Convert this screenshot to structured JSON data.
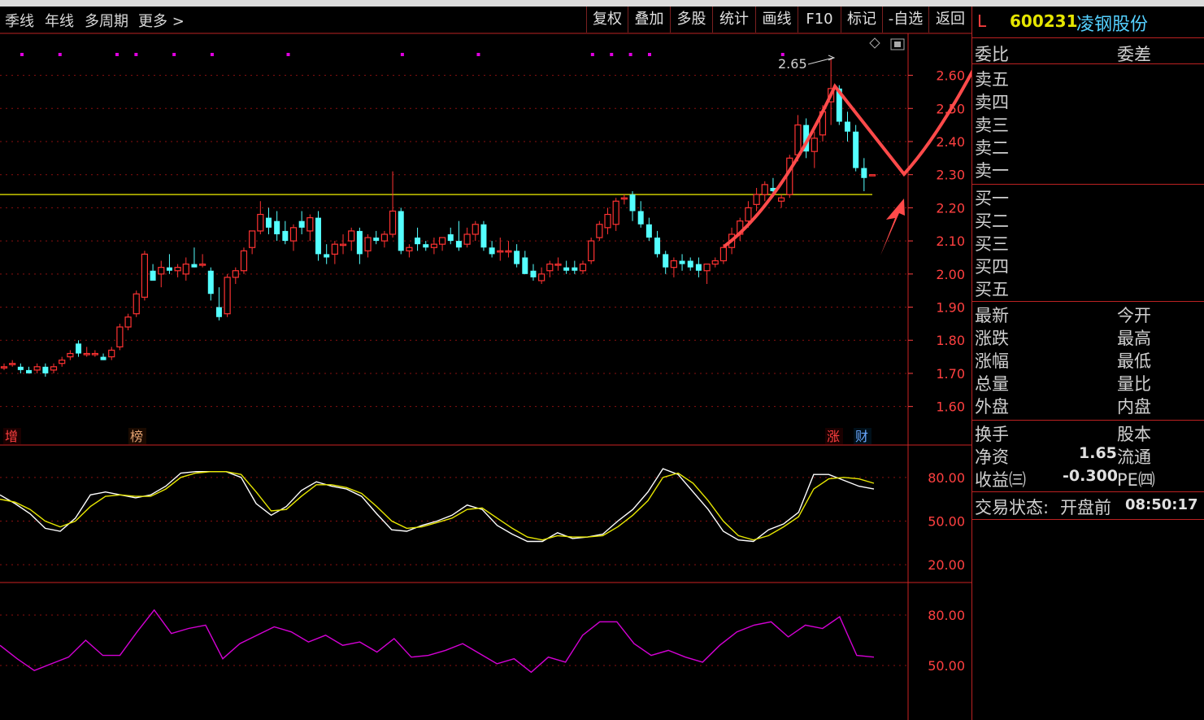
{
  "toolbar": {
    "left": [
      "季线",
      "年线",
      "多周期",
      "更多 >"
    ],
    "buttons": [
      "复权",
      "叠加",
      "多股",
      "统计",
      "画线",
      "F10",
      "标记",
      "-自选",
      "返回"
    ]
  },
  "stock": {
    "prefix": "L",
    "code": "600231",
    "name": "凌钢股份"
  },
  "order_book": {
    "header_left": "委比",
    "header_right": "委差",
    "asks": [
      "卖五",
      "卖四",
      "卖三",
      "卖二",
      "卖一"
    ],
    "bids": [
      "买一",
      "买二",
      "买三",
      "买四",
      "买五"
    ]
  },
  "quote_labels": {
    "left": [
      "最新",
      "涨跌",
      "涨幅",
      "总量",
      "外盘"
    ],
    "right": [
      "今开",
      "最高",
      "最低",
      "量比",
      "内盘"
    ]
  },
  "fundamentals": {
    "turnover_label": "换手",
    "share_cap_label": "股本",
    "net_asset_label": "净资",
    "net_asset_value": "1.65",
    "float_label": "流通",
    "eps_label": "收益㈢",
    "eps_value": "-0.300",
    "pe_label": "PE㈣"
  },
  "status": {
    "label": "交易状态:",
    "state": "开盘前",
    "time": "08:50:17"
  },
  "chart_markers": {
    "zeng": "增",
    "bang": "榜",
    "zhang": "涨",
    "cai": "财"
  },
  "colors": {
    "up": "#ff3232",
    "down": "#54ffff",
    "grid": "#8a1010",
    "axis": "#ff4040",
    "kd_k": "#ffffff",
    "kd_d": "#e6e600",
    "rsi": "#d400d4",
    "resistance": "#c8c800",
    "annotation": "#ff4a4a"
  },
  "chart_data": [
    {
      "type": "candlestick",
      "y_ticks": [
        "2.60",
        "2.50",
        "2.40",
        "2.30",
        "2.20",
        "2.10",
        "2.00",
        "1.90",
        "1.80",
        "1.70",
        "1.60"
      ],
      "ylim": [
        1.55,
        2.68
      ],
      "max_annotation": "2.65",
      "resistance_level": 2.24,
      "candles": [
        [
          1.72,
          1.73,
          1.71,
          1.72
        ],
        [
          1.73,
          1.74,
          1.72,
          1.73
        ],
        [
          1.72,
          1.73,
          1.7,
          1.71
        ],
        [
          1.71,
          1.72,
          1.7,
          1.7
        ],
        [
          1.71,
          1.73,
          1.7,
          1.72
        ],
        [
          1.72,
          1.73,
          1.69,
          1.7
        ],
        [
          1.71,
          1.73,
          1.7,
          1.72
        ],
        [
          1.73,
          1.75,
          1.72,
          1.74
        ],
        [
          1.75,
          1.77,
          1.74,
          1.76
        ],
        [
          1.79,
          1.8,
          1.75,
          1.76
        ],
        [
          1.76,
          1.78,
          1.75,
          1.76
        ],
        [
          1.76,
          1.77,
          1.75,
          1.76
        ],
        [
          1.75,
          1.76,
          1.74,
          1.74
        ],
        [
          1.75,
          1.78,
          1.74,
          1.77
        ],
        [
          1.78,
          1.85,
          1.77,
          1.84
        ],
        [
          1.84,
          1.88,
          1.83,
          1.87
        ],
        [
          1.88,
          1.95,
          1.87,
          1.94
        ],
        [
          1.93,
          2.07,
          1.92,
          2.06
        ],
        [
          2.01,
          2.03,
          1.98,
          1.98
        ],
        [
          2.0,
          2.04,
          1.96,
          2.02
        ],
        [
          2.02,
          2.06,
          2.0,
          2.01
        ],
        [
          2.01,
          2.03,
          1.99,
          2.02
        ],
        [
          2.0,
          2.05,
          1.98,
          2.03
        ],
        [
          2.03,
          2.08,
          2.02,
          2.02
        ],
        [
          2.03,
          2.06,
          2.02,
          2.03
        ],
        [
          2.01,
          2.02,
          1.92,
          1.94
        ],
        [
          1.9,
          1.96,
          1.86,
          1.87
        ],
        [
          1.88,
          2.0,
          1.87,
          1.99
        ],
        [
          1.99,
          2.02,
          1.97,
          2.01
        ],
        [
          2.01,
          2.08,
          2.0,
          2.07
        ],
        [
          2.08,
          2.13,
          2.06,
          2.13
        ],
        [
          2.13,
          2.22,
          2.12,
          2.18
        ],
        [
          2.17,
          2.2,
          2.12,
          2.14
        ],
        [
          2.16,
          2.19,
          2.1,
          2.12
        ],
        [
          2.13,
          2.16,
          2.09,
          2.1
        ],
        [
          2.1,
          2.15,
          2.07,
          2.14
        ],
        [
          2.16,
          2.19,
          2.12,
          2.14
        ],
        [
          2.13,
          2.18,
          2.1,
          2.17
        ],
        [
          2.17,
          2.19,
          2.04,
          2.06
        ],
        [
          2.06,
          2.09,
          2.03,
          2.05
        ],
        [
          2.06,
          2.1,
          2.03,
          2.09
        ],
        [
          2.09,
          2.12,
          2.06,
          2.09
        ],
        [
          2.1,
          2.14,
          2.07,
          2.13
        ],
        [
          2.13,
          2.14,
          2.03,
          2.06
        ],
        [
          2.07,
          2.12,
          2.05,
          2.11
        ],
        [
          2.11,
          2.13,
          2.09,
          2.1
        ],
        [
          2.1,
          2.13,
          2.08,
          2.12
        ],
        [
          2.12,
          2.31,
          2.11,
          2.19
        ],
        [
          2.19,
          2.2,
          2.06,
          2.07
        ],
        [
          2.07,
          2.09,
          2.05,
          2.08
        ],
        [
          2.11,
          2.14,
          2.07,
          2.09
        ],
        [
          2.09,
          2.1,
          2.07,
          2.08
        ],
        [
          2.08,
          2.11,
          2.06,
          2.09
        ],
        [
          2.09,
          2.11,
          2.07,
          2.11
        ],
        [
          2.12,
          2.14,
          2.09,
          2.1
        ],
        [
          2.1,
          2.16,
          2.07,
          2.08
        ],
        [
          2.09,
          2.14,
          2.08,
          2.12
        ],
        [
          2.12,
          2.16,
          2.1,
          2.15
        ],
        [
          2.15,
          2.16,
          2.07,
          2.08
        ],
        [
          2.08,
          2.1,
          2.05,
          2.06
        ],
        [
          2.07,
          2.11,
          2.04,
          2.07
        ],
        [
          2.07,
          2.1,
          2.05,
          2.07
        ],
        [
          2.07,
          2.09,
          2.02,
          2.03
        ],
        [
          2.05,
          2.07,
          2.0,
          2.0
        ],
        [
          2.01,
          2.03,
          1.98,
          1.99
        ],
        [
          1.98,
          2.02,
          1.97,
          2.0
        ],
        [
          2.01,
          2.04,
          1.99,
          2.03
        ],
        [
          2.03,
          2.05,
          2.01,
          2.03
        ],
        [
          2.02,
          2.04,
          2.0,
          2.01
        ],
        [
          2.02,
          2.04,
          2.0,
          2.01
        ],
        [
          2.01,
          2.04,
          2.0,
          2.03
        ],
        [
          2.04,
          2.11,
          2.03,
          2.1
        ],
        [
          2.11,
          2.16,
          2.1,
          2.15
        ],
        [
          2.14,
          2.2,
          2.12,
          2.18
        ],
        [
          2.15,
          2.23,
          2.13,
          2.22
        ],
        [
          2.23,
          2.24,
          2.21,
          2.23
        ],
        [
          2.24,
          2.25,
          2.16,
          2.19
        ],
        [
          2.19,
          2.22,
          2.14,
          2.15
        ],
        [
          2.15,
          2.17,
          2.1,
          2.11
        ],
        [
          2.11,
          2.13,
          2.05,
          2.06
        ],
        [
          2.06,
          2.07,
          2.0,
          2.02
        ],
        [
          2.02,
          2.05,
          1.99,
          2.04
        ],
        [
          2.04,
          2.06,
          2.01,
          2.03
        ],
        [
          2.04,
          2.05,
          2.01,
          2.02
        ],
        [
          2.03,
          2.05,
          1.99,
          2.01
        ],
        [
          2.01,
          2.03,
          1.97,
          2.03
        ],
        [
          2.03,
          2.05,
          2.02,
          2.04
        ],
        [
          2.04,
          2.09,
          2.03,
          2.08
        ],
        [
          2.08,
          2.14,
          2.06,
          2.12
        ],
        [
          2.12,
          2.17,
          2.1,
          2.16
        ],
        [
          2.16,
          2.22,
          2.14,
          2.2
        ],
        [
          2.21,
          2.26,
          2.19,
          2.24
        ],
        [
          2.24,
          2.28,
          2.22,
          2.27
        ],
        [
          2.26,
          2.29,
          2.24,
          2.25
        ],
        [
          2.22,
          2.24,
          2.2,
          2.23
        ],
        [
          2.24,
          2.36,
          2.23,
          2.35
        ],
        [
          2.36,
          2.48,
          2.34,
          2.45
        ],
        [
          2.45,
          2.47,
          2.35,
          2.37
        ],
        [
          2.37,
          2.43,
          2.32,
          2.41
        ],
        [
          2.42,
          2.51,
          2.4,
          2.49
        ],
        [
          2.52,
          2.65,
          2.45,
          2.56
        ],
        [
          2.56,
          2.57,
          2.45,
          2.46
        ],
        [
          2.46,
          2.49,
          2.4,
          2.43
        ],
        [
          2.43,
          2.45,
          2.31,
          2.32
        ],
        [
          2.32,
          2.35,
          2.25,
          2.29
        ],
        [
          2.3,
          2.3,
          2.3,
          2.3
        ]
      ],
      "signal_dot_columns": [
        0,
        2,
        5,
        6,
        8,
        10,
        14,
        20,
        24,
        30,
        31,
        32,
        33,
        40,
        48,
        49,
        50,
        55,
        59,
        62,
        64,
        66
      ]
    },
    {
      "type": "line",
      "y_ticks": [
        "80.00",
        "50.00",
        "20.00"
      ],
      "ylim": [
        10,
        95
      ],
      "series": [
        {
          "values": [
            68,
            62,
            55,
            45,
            43,
            52,
            68,
            70,
            68,
            66,
            68,
            74,
            83,
            84,
            84,
            84,
            80,
            62,
            54,
            60,
            71,
            77,
            74,
            72,
            67,
            55,
            44,
            43,
            47,
            50,
            54,
            61,
            58,
            47,
            41,
            36,
            36,
            42,
            38,
            39,
            41,
            50,
            58,
            70,
            86,
            82,
            70,
            58,
            43,
            37,
            36,
            44,
            48,
            56,
            82,
            82,
            78,
            74,
            72
          ]
        },
        {
          "values": [
            65,
            63,
            58,
            50,
            46,
            50,
            60,
            67,
            68,
            67,
            67,
            72,
            80,
            83,
            84,
            84,
            82,
            70,
            57,
            58,
            67,
            75,
            75,
            73,
            69,
            60,
            50,
            45,
            46,
            49,
            52,
            58,
            59,
            52,
            45,
            39,
            37,
            40,
            39,
            39,
            40,
            46,
            54,
            64,
            80,
            83,
            76,
            64,
            50,
            40,
            37,
            40,
            46,
            53,
            72,
            79,
            80,
            79,
            76
          ]
        }
      ]
    },
    {
      "type": "line",
      "y_ticks": [
        "80.00",
        "50.00"
      ],
      "ylim": [
        20,
        95
      ],
      "series": [
        {
          "values": [
            62,
            54,
            47,
            51,
            55,
            65,
            56,
            56,
            70,
            83,
            69,
            72,
            74,
            54,
            63,
            68,
            73,
            70,
            64,
            68,
            62,
            64,
            58,
            66,
            55,
            56,
            59,
            63,
            57,
            51,
            54,
            46,
            55,
            52,
            68,
            76,
            76,
            63,
            56,
            59,
            55,
            52,
            62,
            70,
            74,
            76,
            67,
            74,
            72,
            79,
            56,
            55
          ]
        }
      ]
    }
  ]
}
